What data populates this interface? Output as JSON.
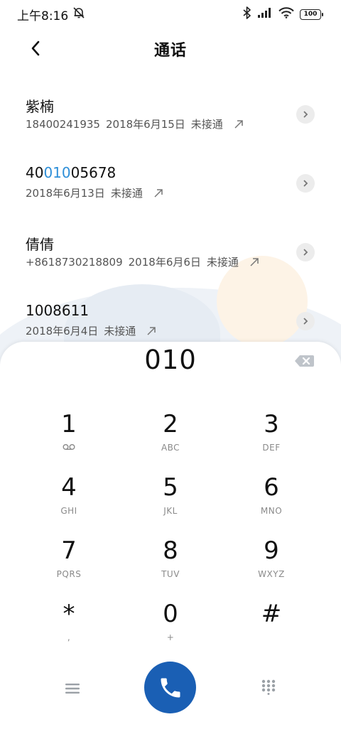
{
  "status_bar": {
    "time": "上午8:16",
    "battery": "100"
  },
  "header": {
    "title": "通话"
  },
  "calls": [
    {
      "name": "紫楠",
      "name_highlight": "",
      "name_rest": "",
      "number": "18400241935",
      "date": "2018年6月15日",
      "status": "未接通"
    },
    {
      "name": "40",
      "name_highlight": "010",
      "name_rest": "05678",
      "number": "",
      "date": "2018年6月13日",
      "status": "未接通"
    },
    {
      "name": "倩倩",
      "name_highlight": "",
      "name_rest": "",
      "number": "+8618730218809",
      "date": "2018年6月6日",
      "status": "未接通"
    },
    {
      "name": "1008611",
      "name_highlight": "",
      "name_rest": "",
      "number": "",
      "date": "2018年6月4日",
      "status": "未接通"
    }
  ],
  "dialpad": {
    "input": "010",
    "keys": [
      {
        "digit": "1",
        "letters": ""
      },
      {
        "digit": "2",
        "letters": "ABC"
      },
      {
        "digit": "3",
        "letters": "DEF"
      },
      {
        "digit": "4",
        "letters": "GHI"
      },
      {
        "digit": "5",
        "letters": "JKL"
      },
      {
        "digit": "6",
        "letters": "MNO"
      },
      {
        "digit": "7",
        "letters": "PQRS"
      },
      {
        "digit": "8",
        "letters": "TUV"
      },
      {
        "digit": "9",
        "letters": "WXYZ"
      },
      {
        "digit": "*",
        "letters": ","
      },
      {
        "digit": "0",
        "letters": "+"
      },
      {
        "digit": "#",
        "letters": ""
      }
    ]
  },
  "icons": {
    "back": "chevron-left-icon",
    "detail": "chevron-right-icon",
    "outgoing": "arrow-up-right-icon",
    "backspace": "backspace-icon",
    "voicemail": "voicemail-icon",
    "call": "phone-icon",
    "menu": "menu-icon",
    "keypad": "dialpad-icon",
    "mute": "bell-off-icon",
    "bluetooth": "bluetooth-icon",
    "signal": "signal-icon",
    "wifi": "wifi-icon"
  },
  "colors": {
    "accent": "#2e8fd8",
    "call_button": "#1a5fb4"
  }
}
